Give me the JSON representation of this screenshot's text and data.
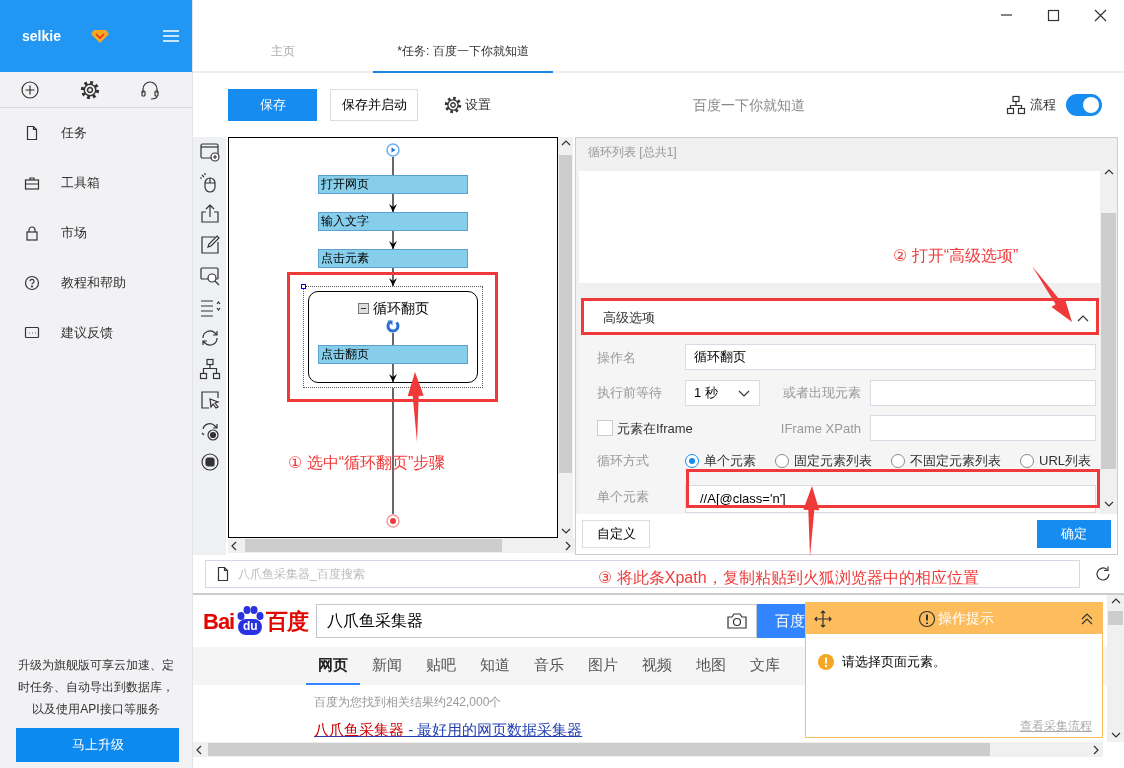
{
  "sidebar": {
    "user": "selkie",
    "items": [
      {
        "label": "任务"
      },
      {
        "label": "工具箱"
      },
      {
        "label": "市场"
      },
      {
        "label": "教程和帮助"
      },
      {
        "label": "建议反馈"
      }
    ],
    "promo": "升级为旗舰版可享云加速、定时任务、自动导出到数据库，以及使用API接口等服务",
    "upgrade_button": "马上升级"
  },
  "tabs": [
    {
      "label": "主页",
      "selected": false
    },
    {
      "label": "*任务: 百度一下你就知道",
      "selected": true
    }
  ],
  "toolbar": {
    "save": "保存",
    "save_and_start": "保存并启动",
    "settings": "设置",
    "task_title": "百度一下你就知道",
    "flow_label": "流程",
    "flow_on": true
  },
  "flow": {
    "steps": [
      {
        "kind": "step",
        "label": "打开网页",
        "selected": false
      },
      {
        "kind": "step",
        "label": "输入文字",
        "selected": false
      },
      {
        "kind": "step",
        "label": "点击元素",
        "selected": false
      },
      {
        "kind": "loop",
        "label": "循环翻页",
        "selected": true,
        "expanded": true,
        "children": [
          {
            "kind": "step",
            "label": "点击翻页",
            "selected": false
          }
        ]
      }
    ]
  },
  "properties": {
    "list_title": "循环列表 [总共1]",
    "advanced": {
      "label": "高级选项",
      "expanded": true
    },
    "name_label": "操作名",
    "name_value": "循环翻页",
    "wait_label": "执行前等待",
    "wait_value": "1 秒",
    "appear_label": "或者出现元素",
    "iframe": {
      "label": "元素在Iframe",
      "checked": false
    },
    "xpath_label": "IFrame XPath",
    "loop_mode_label": "循环方式",
    "loop_modes": [
      {
        "label": "单个元素",
        "selected": true
      },
      {
        "label": "固定元素列表",
        "selected": false
      },
      {
        "label": "不固定元素列表",
        "selected": false
      },
      {
        "label": "URL列表",
        "selected": false
      }
    ],
    "single_label": "单个元素",
    "single_value": "//A[@class='n']",
    "custom_button": "自定义",
    "ok_button": "确定"
  },
  "browser": {
    "address": "八爪鱼采集器_百度搜索",
    "logo": [
      "Bai",
      "du",
      "百度"
    ],
    "query": "八爪鱼采集器",
    "search_button": "百度",
    "nav": [
      {
        "label": "网页",
        "selected": true
      },
      {
        "label": "新闻",
        "selected": false
      },
      {
        "label": "贴吧",
        "selected": false
      },
      {
        "label": "知道",
        "selected": false
      },
      {
        "label": "音乐",
        "selected": false
      },
      {
        "label": "图片",
        "selected": false
      },
      {
        "label": "视频",
        "selected": false
      },
      {
        "label": "地图",
        "selected": false
      },
      {
        "label": "文库",
        "selected": false
      }
    ],
    "result_count": "百度为您找到相关结果约242,000个",
    "result": {
      "highlight": "八爪鱼采集器",
      "rest": " - 最好用的网页数据采集器"
    }
  },
  "tip": {
    "title": "操作提示",
    "message": "请选择页面元素。",
    "link": "查看采集流程"
  },
  "annotations": [
    {
      "text": "① 选中“循环翻页”步骤"
    },
    {
      "text": "② 打开“高级选项”"
    },
    {
      "text": "③ 将此条Xpath，复制粘贴到火狐浏览器中的相应位置"
    }
  ]
}
